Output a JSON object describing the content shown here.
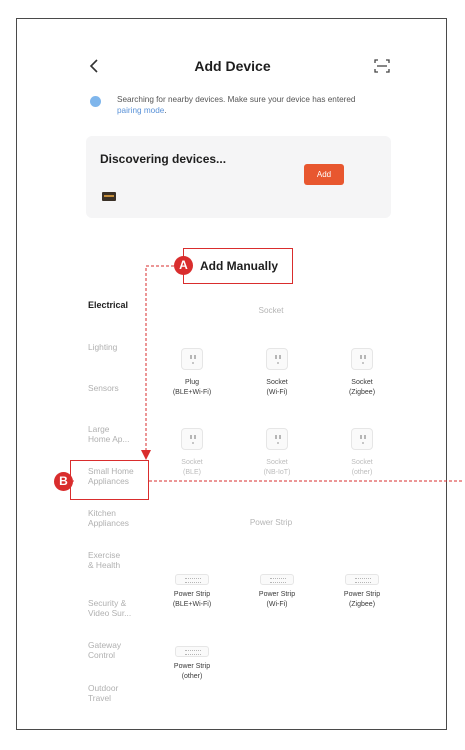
{
  "header": {
    "title": "Add Device"
  },
  "notice": {
    "text": "Searching for nearby devices. Make sure your device has entered ",
    "link": "pairing mode",
    "end": "."
  },
  "discovering": {
    "title": "Discovering devices...",
    "add_label": "Add"
  },
  "manual": {
    "label": "Add Manually",
    "marker": "A"
  },
  "callout_b": {
    "marker": "B"
  },
  "categories": [
    "Electrical",
    "Lighting",
    "Sensors",
    "Large\nHome Ap...",
    "Small Home\nAppliances",
    "Kitchen\nAppliances",
    "Exercise\n& Health",
    "Security &\nVideo Sur...",
    "Gateway\nControl",
    "Outdoor\nTravel"
  ],
  "sections": {
    "socket": "Socket",
    "power_strip": "Power Strip"
  },
  "socket_tiles": [
    "Plug\n(BLE+Wi-Fi)",
    "Socket\n(Wi-Fi)",
    "Socket\n(Zigbee)",
    "Socket\n(BLE)",
    "Socket\n(NB-IoT)",
    "Socket\n(other)"
  ],
  "strip_tiles": [
    "Power Strip\n(BLE+Wi-Fi)",
    "Power Strip\n(Wi-Fi)",
    "Power Strip\n(Zigbee)",
    "Power Strip\n(other)"
  ],
  "colors": {
    "accent": "#e8572f",
    "annotation": "#d92d2d",
    "link": "#5a92d8"
  }
}
